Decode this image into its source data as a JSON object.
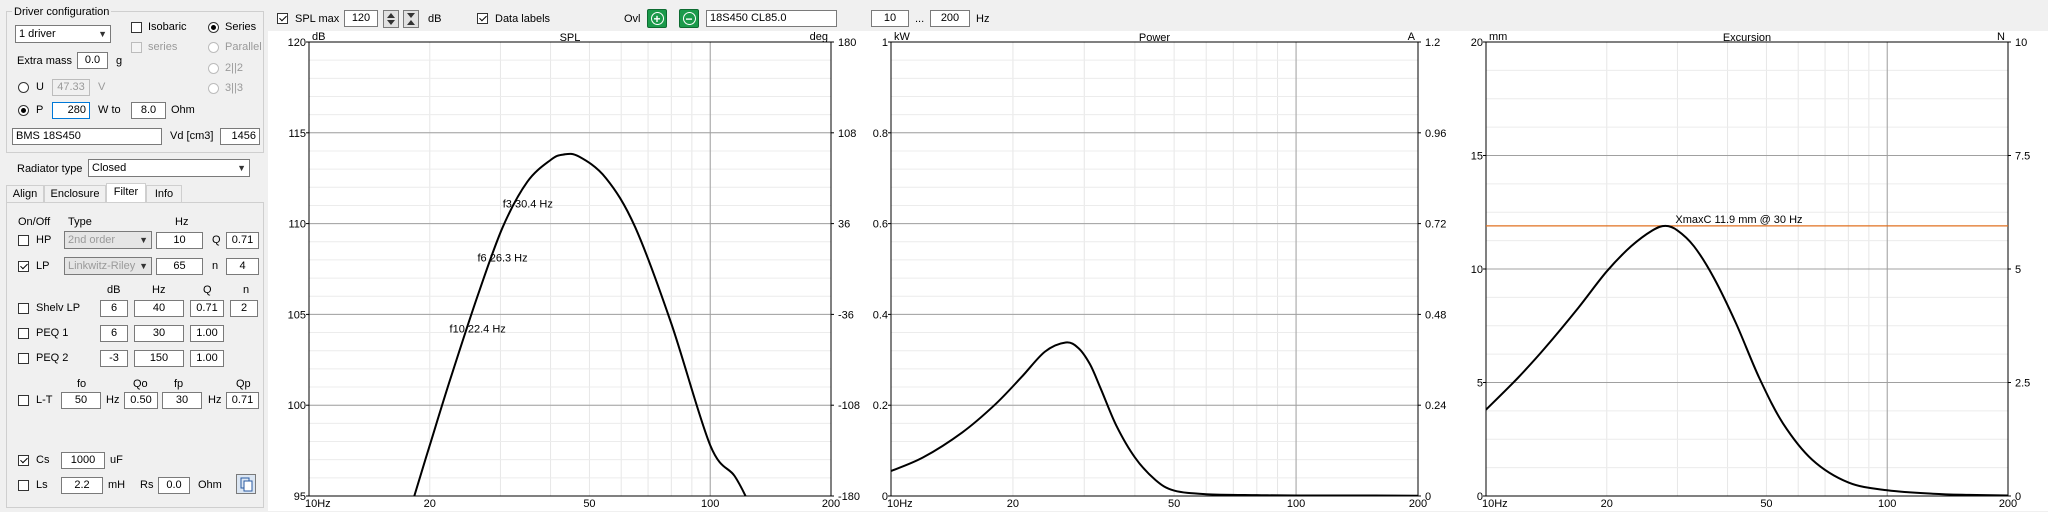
{
  "driver_config": {
    "group_title": "Driver configuration",
    "driver_count": "1 driver",
    "isobaric": "Isobaric",
    "series_sub": "series",
    "series": "Series",
    "parallel": "Parallel",
    "opt_2_2": "2||2",
    "opt_3_3": "3||3",
    "extra_mass_label": "Extra mass",
    "extra_mass_value": "0.0",
    "extra_mass_unit": "g",
    "u_label": "U",
    "u_value": "47.33",
    "u_unit": "V",
    "p_label": "P",
    "p_value": "280",
    "w_to_label": "W to",
    "ohm_value": "8.0",
    "ohm_unit": "Ohm",
    "driver_name": "BMS 18S450",
    "vd_label": "Vd [cm3]",
    "vd_value": "1456"
  },
  "radiator": {
    "label": "Radiator type",
    "value": "Closed"
  },
  "tabs": [
    "Align",
    "Enclosure",
    "Filter",
    "Info"
  ],
  "filter": {
    "col_onoff": "On/Off",
    "col_type": "Type",
    "col_hz": "Hz",
    "hp": {
      "label": "HP",
      "type": "2nd order",
      "hz": "10",
      "q_label": "Q",
      "q": "0.71"
    },
    "lp": {
      "label": "LP",
      "type": "Linkwitz-Riley",
      "hz": "65",
      "n_label": "n",
      "n": "4"
    },
    "peq_head": {
      "db": "dB",
      "hz": "Hz",
      "q": "Q",
      "n": "n"
    },
    "shelv": {
      "label": "Shelv LP",
      "db": "6",
      "hz": "40",
      "q": "0.71",
      "n": "2"
    },
    "peq1": {
      "label": "PEQ 1",
      "db": "6",
      "hz": "30",
      "q": "1.00"
    },
    "peq2": {
      "label": "PEQ 2",
      "db": "-3",
      "hz": "150",
      "q": "1.00"
    },
    "lt_head": {
      "fo": "fo",
      "qo": "Qo",
      "fp": "fp",
      "qp": "Qp"
    },
    "lt": {
      "label": "L-T",
      "fo": "50",
      "hz1": "Hz",
      "qo": "0.50",
      "fp": "30",
      "hz2": "Hz",
      "qp": "0.71"
    },
    "cs": {
      "label": "Cs",
      "value": "1000",
      "unit": "uF"
    },
    "ls": {
      "label": "Ls",
      "value": "2.2",
      "unit": "mH",
      "rs_label": "Rs",
      "rs_value": "0.0",
      "rs_unit": "Ohm"
    }
  },
  "toolbar": {
    "spl_max_label": "SPL max",
    "spl_max_value": "120",
    "db_unit": "dB",
    "data_labels": "Data labels",
    "ovl_label": "Ovl",
    "plus": "+",
    "minus": "−",
    "overlay_name": "18S450 CL85.0",
    "freq_from": "10",
    "freq_sep": "...",
    "freq_to": "200",
    "freq_unit": "Hz"
  },
  "colors": {
    "accent_green": "#1a9a4a",
    "xmax_line": "#e07020",
    "curve": "#000000",
    "grid": "#a0a0a0"
  },
  "icons": {
    "spin": "spin-updown-icon",
    "fit": "fit-icon",
    "copy": "copy-icon",
    "add": "plus-icon",
    "remove": "minus-icon"
  },
  "chart_data": [
    {
      "type": "line",
      "title": "SPL",
      "left_unit": "dB",
      "right_unit": "deg",
      "x_ticks": [
        "10Hz",
        "20",
        "50",
        "100",
        "200"
      ],
      "y_ticks": [
        "120",
        "115",
        "110",
        "105",
        "100",
        "95"
      ],
      "y2_ticks": [
        "180",
        "108",
        "36",
        "-36",
        "-108",
        "-180"
      ],
      "ylim": [
        95,
        120
      ],
      "y2lim": [
        -180,
        180
      ],
      "xlim": [
        10,
        200
      ],
      "x_scale": "log",
      "grid": true,
      "series": [
        {
          "x": [
            18.3,
            20,
            22.4,
            26.3,
            30.4,
            35,
            40,
            43,
            47,
            55,
            65,
            80,
            100,
            115,
            125
          ],
          "y": [
            95,
            97.8,
            101.3,
            106.0,
            109.8,
            112.3,
            113.5,
            113.8,
            113.7,
            112.5,
            109.8,
            104.5,
            97.8,
            96.1,
            94.6
          ]
        }
      ],
      "annotations": [
        {
          "text": "f3 30.4 Hz",
          "x": 30.4,
          "y": 110.9
        },
        {
          "text": "f6 26.3 Hz",
          "x": 26.3,
          "y": 107.9
        },
        {
          "text": "f10 22.4 Hz",
          "x": 22.4,
          "y": 104.0
        }
      ]
    },
    {
      "type": "line",
      "title": "Power",
      "left_unit": "kW",
      "right_unit": "A",
      "x_ticks": [
        "10Hz",
        "20",
        "50",
        "100",
        "200"
      ],
      "y_ticks": [
        "1",
        "0.8",
        "0.6",
        "0.4",
        "0.2",
        "0"
      ],
      "y2_ticks": [
        "1.2",
        "0.96",
        "0.72",
        "0.48",
        "0.24",
        "0"
      ],
      "ylim": [
        0,
        1
      ],
      "y2lim": [
        0,
        1.2
      ],
      "xlim": [
        10,
        200
      ],
      "x_scale": "log",
      "grid": true,
      "series": [
        {
          "x": [
            10,
            12,
            15,
            18,
            21,
            24,
            27,
            29,
            31,
            33,
            36,
            40,
            45,
            50,
            60,
            80,
            100,
            150,
            200
          ],
          "y": [
            0.055,
            0.085,
            0.14,
            0.2,
            0.262,
            0.318,
            0.338,
            0.326,
            0.29,
            0.235,
            0.155,
            0.085,
            0.035,
            0.012,
            0.004,
            0.002,
            0.001,
            0.001,
            0.0005
          ]
        }
      ]
    },
    {
      "type": "line",
      "title": "Excursion",
      "left_unit": "mm",
      "right_unit": "N",
      "x_ticks": [
        "10Hz",
        "20",
        "50",
        "100",
        "200"
      ],
      "y_ticks": [
        "20",
        "15",
        "10",
        "5",
        "0"
      ],
      "y2_ticks": [
        "10",
        "7.5",
        "5",
        "2.5",
        "0"
      ],
      "ylim": [
        0,
        20
      ],
      "y2lim": [
        0,
        10
      ],
      "xlim": [
        10,
        200
      ],
      "x_scale": "log",
      "grid": true,
      "series": [
        {
          "x": [
            10,
            12,
            14,
            17,
            20,
            23,
            26,
            28,
            30,
            33,
            37,
            42,
            48,
            55,
            65,
            80,
            100,
            130,
            160,
            200
          ],
          "y": [
            3.8,
            5.2,
            6.5,
            8.3,
            9.9,
            11.0,
            11.7,
            11.9,
            11.7,
            11.0,
            9.6,
            7.6,
            5.2,
            3.2,
            1.6,
            0.6,
            0.25,
            0.1,
            0.05,
            0.02
          ]
        }
      ],
      "hline": {
        "y": 11.9,
        "label": "XmaxC 11.9 mm  @ 30 Hz"
      }
    }
  ]
}
